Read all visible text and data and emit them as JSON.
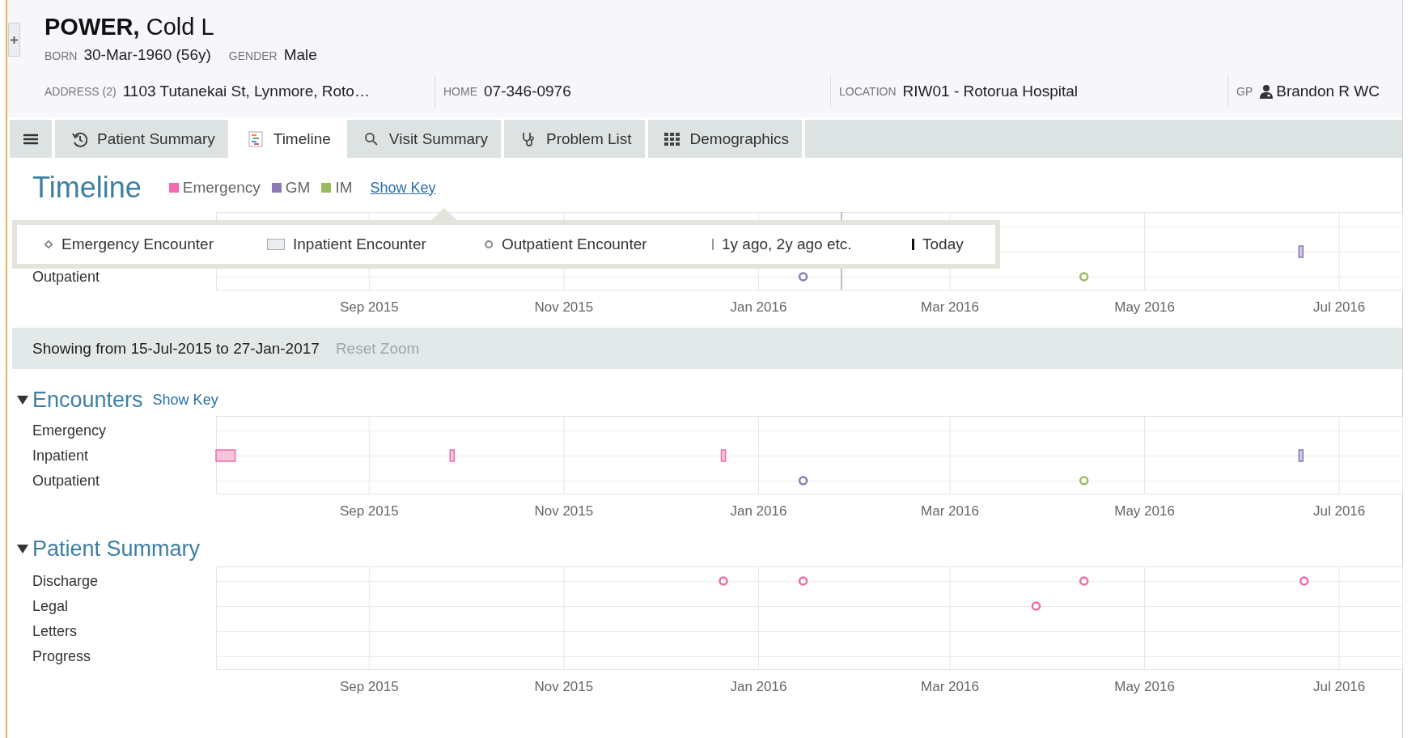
{
  "patient": {
    "name": "**POWER,** Cold L",
    "fields": [
      {
        "label": "BORN",
        "value": "30-Mar-1960 (56y)"
      },
      {
        "label": "GENDER",
        "value": "Male"
      }
    ],
    "contact": [
      {
        "label": "ADDRESS (2)",
        "value": "1103 Tutanekai St, Lynmore, Roto…",
        "kind": "text"
      },
      {
        "label": "HOME",
        "value": "07-346-0976",
        "kind": "text"
      },
      {
        "label": "LOCATION",
        "value": "RIW01 - Rotorua Hospital",
        "kind": "text"
      },
      {
        "label": "GP",
        "value": "Brandon R WC",
        "kind": "person"
      }
    ]
  },
  "tabs": [
    {
      "label": "Patient Summary",
      "selected": false
    },
    {
      "label": "Timeline",
      "selected": true
    },
    {
      "label": "Visit Summary",
      "selected": false
    },
    {
      "label": "Problem List",
      "selected": false
    },
    {
      "label": "Demographics",
      "selected": false
    }
  ],
  "timeline": {
    "title": "Timeline",
    "legend": [
      {
        "label": "Emergency",
        "color": "#f06ba8"
      },
      {
        "label": "GM",
        "color": "#8b78b6"
      },
      {
        "label": "IM",
        "color": "#9aba5b"
      }
    ],
    "show_key": "Show Key",
    "key_open": true,
    "key": [
      {
        "label": "Emergency Encounter",
        "kind": "emergency"
      },
      {
        "label": "Inpatient Encounter",
        "kind": "inpatient"
      },
      {
        "label": "Outpatient Encounter",
        "kind": "outpatient"
      },
      {
        "label": "1y ago, 2y ago etc.",
        "kind": "year-ago"
      },
      {
        "label": "Today",
        "kind": "today"
      }
    ],
    "chart": {
      "row_labels": [
        "Outpatient"
      ],
      "axis_labels": [
        "Sep 2015",
        "Nov 2015",
        "Jan 2016",
        "Mar 2016",
        "May 2016",
        "Jul 2016"
      ]
    }
  },
  "range": {
    "text": "Showing from 15-Jul-2015 to 27-Jan-2017",
    "reset": {
      "label": "Reset Zoom",
      "disabled": true
    }
  },
  "sections": [
    {
      "title": "Encounters",
      "expanded": true,
      "show_key": "Show Key",
      "chart": {
        "row_labels": [
          "Emergency",
          "Inpatient",
          "Outpatient"
        ],
        "axis_labels": [
          "Sep 2015",
          "Nov 2015",
          "Jan 2016",
          "Mar 2016",
          "May 2016",
          "Jul 2016"
        ]
      }
    },
    {
      "title": "Patient Summary",
      "expanded": true,
      "chart": {
        "row_labels": [
          "Discharge",
          "Legal",
          "Letters",
          "Progress"
        ],
        "axis_labels": [
          "Sep 2015",
          "Nov 2015",
          "Jan 2016",
          "Mar 2016",
          "May 2016",
          "Jul 2016"
        ]
      }
    }
  ]
}
